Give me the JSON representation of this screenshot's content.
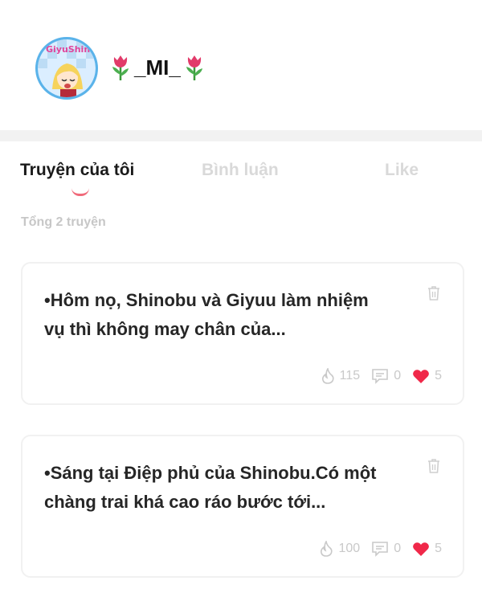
{
  "profile": {
    "username": "_MI_",
    "avatar_text": "GiyuShino",
    "decor_icons": [
      "tulip-icon",
      "tulip-icon"
    ]
  },
  "tabs": [
    {
      "label": "Truyện của tôi",
      "active": true
    },
    {
      "label": "Bình luận",
      "active": false
    },
    {
      "label": "Like",
      "active": false
    }
  ],
  "total_label": "Tổng 2 truyện",
  "stories": [
    {
      "title": "•Hôm nọ, Shinobu và Giyuu làm nhiệm vụ thì không may chân của...",
      "views": "115",
      "comments": "0",
      "likes": "5"
    },
    {
      "title": "•Sáng tại Điệp phủ của Shinobu.Có một chàng trai khá cao ráo bước tới...",
      "views": "100",
      "comments": "0",
      "likes": "5"
    }
  ],
  "colors": {
    "accent": "#f06a7a",
    "like_heart": "#f02849",
    "muted": "#c9c9c9",
    "avatar_ring": "#5ab3ea"
  }
}
